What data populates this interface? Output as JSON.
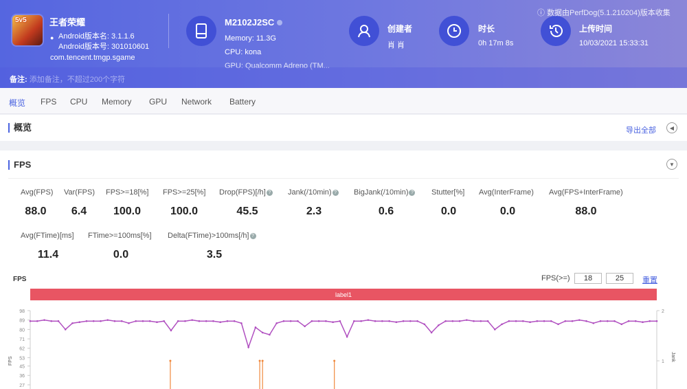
{
  "header": {
    "app_name": "王者荣耀",
    "app_icon_text": "5v5",
    "version_name": "Android版本名: 3.1.1.6",
    "version_code": "Android版本号: 301010601",
    "package": "com.tencent.tmgp.sgame",
    "device": "M2102J2SC",
    "memory": "Memory: 11.3G",
    "cpu": "CPU: kona",
    "gpu": "GPU: Qualcomm Adreno (TM...",
    "creator_label": "创建者",
    "creator": "肖 肖",
    "duration_label": "时长",
    "duration": "0h 17m 8s",
    "upload_label": "上传时间",
    "upload_time": "10/03/2021 15:33:31",
    "collected_by": "数据由PerfDog(5.1.210204)版本收集",
    "remark_label": "备注:",
    "remark_placeholder": "添加备注，不超过200个字符"
  },
  "tabs": [
    "概览",
    "FPS",
    "CPU",
    "Memory",
    "GPU",
    "Network",
    "Battery"
  ],
  "overview": {
    "title": "概览",
    "export": "导出全部"
  },
  "fps_section": {
    "title": "FPS",
    "metrics_row1": [
      {
        "label": "Avg(FPS)",
        "value": "88.0"
      },
      {
        "label": "Var(FPS)",
        "value": "6.4"
      },
      {
        "label": "FPS>=18[%]",
        "value": "100.0"
      },
      {
        "label": "FPS>=25[%]",
        "value": "100.0"
      },
      {
        "label": "Drop(FPS)[/h]",
        "value": "45.5"
      },
      {
        "label": "Jank(/10min)",
        "value": "2.3"
      },
      {
        "label": "BigJank(/10min)",
        "value": "0.6"
      },
      {
        "label": "Stutter[%]",
        "value": "0.0"
      },
      {
        "label": "Avg(InterFrame)",
        "value": "0.0"
      },
      {
        "label": "Avg(FPS+InterFrame)",
        "value": "88.0"
      }
    ],
    "metrics_row2": [
      {
        "label": "Avg(FTime)[ms]",
        "value": "11.4"
      },
      {
        "label": "FTime>=100ms[%]",
        "value": "0.0"
      },
      {
        "label": "Delta(FTime)>100ms[/h]",
        "value": "3.5"
      }
    ],
    "threshold_label": "FPS(>=)",
    "threshold1": "18",
    "threshold2": "25",
    "reset": "重置"
  },
  "colors": {
    "accent": "#4a63e0",
    "label_bar": "#e85563",
    "fps_line": "#b04fc0",
    "jank": "#f0883c"
  },
  "chart_data": {
    "type": "line",
    "title": "FPS",
    "label_band": "label1",
    "ylabel": "FPS",
    "y2label": "Jank",
    "yticks": [
      98,
      89,
      80,
      71,
      62,
      53,
      45,
      36,
      27
    ],
    "ylim": [
      27,
      98
    ],
    "y2ticks": [
      2,
      1
    ],
    "y2lim": [
      0,
      2
    ],
    "series": [
      {
        "name": "FPS",
        "values": [
          88,
          88,
          89,
          88,
          88,
          80,
          86,
          87,
          88,
          88,
          88,
          89,
          88,
          88,
          86,
          88,
          88,
          88,
          87,
          88,
          79,
          88,
          88,
          89,
          88,
          88,
          88,
          87,
          88,
          88,
          86,
          63,
          82,
          77,
          75,
          86,
          88,
          88,
          88,
          83,
          88,
          88,
          88,
          87,
          88,
          73,
          88,
          88,
          89,
          88,
          88,
          88,
          87,
          88,
          88,
          88,
          85,
          77,
          84,
          88,
          88,
          88,
          89,
          88,
          88,
          88,
          80,
          85,
          88,
          88,
          88,
          87,
          88,
          88,
          88,
          85,
          88,
          88,
          89,
          88,
          86,
          88,
          88,
          88,
          85,
          88,
          88,
          87,
          88,
          88
        ]
      },
      {
        "name": "Jank",
        "x": [
          19.9,
          32.6,
          33.0,
          43.2
        ],
        "values": [
          1,
          1,
          1,
          1
        ]
      }
    ]
  }
}
